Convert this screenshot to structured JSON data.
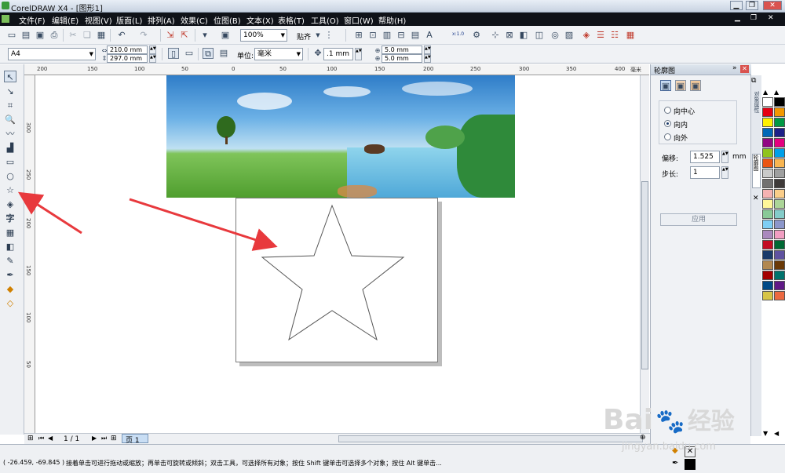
{
  "window": {
    "title": "CorelDRAW X4 - [图形1]"
  },
  "menu": [
    "文件(F)",
    "编辑(E)",
    "视图(V)",
    "版面(L)",
    "排列(A)",
    "效果(C)",
    "位图(B)",
    "文本(X)",
    "表格(T)",
    "工具(O)",
    "窗口(W)",
    "帮助(H)"
  ],
  "toolbar1": {
    "zoom": "100%",
    "snap": "贴齐",
    "small_label": "x:1.0"
  },
  "toolbar2": {
    "paper": "A4",
    "width": "210.0 mm",
    "height": "297.0 mm",
    "unit_label": "单位:",
    "unit": "毫米",
    "nudge": ".1 mm",
    "dup_x": "5.0 mm",
    "dup_y": "5.0 mm"
  },
  "ruler": {
    "h": [
      "200",
      "150",
      "100",
      "50",
      "0",
      "50",
      "100",
      "150",
      "200",
      "250",
      "300",
      "350",
      "400"
    ],
    "h_unit": "毫米",
    "v": [
      "300",
      "250",
      "200",
      "150",
      "100",
      "50"
    ]
  },
  "toolbox": {
    "text_tool": "字"
  },
  "panel": {
    "title": "轮廓图",
    "options": [
      "向中心",
      "向内",
      "向外"
    ],
    "selected": "向内",
    "offset_label": "偏移:",
    "offset_value": "1.525",
    "offset_unit": "mm",
    "steps_label": "步长:",
    "steps_value": "1",
    "apply_label": "应用"
  },
  "dock_tabs": [
    "对象属性",
    "轮廓图"
  ],
  "page_nav": {
    "counter": "1 / 1",
    "tab": "页 1"
  },
  "status": {
    "coords": "( -26.459, -69.845 )",
    "hint": "接着单击可进行拖动或缩放；再单击可旋转或倾斜；双击工具，可选择所有对象；按住 Shift 键单击可选择多个对象；按住 Alt 键单击..."
  },
  "watermark": {
    "brand": "Bai",
    "cn": "经验",
    "url": "jingyan.baidu.com"
  },
  "colors": {
    "menubar": "#0f1218",
    "accent": "#e8393d",
    "palette": [
      "#ffffff",
      "#000000",
      "#e60012",
      "#f39800",
      "#fff100",
      "#009944",
      "#0068b7",
      "#1d2088",
      "#920783",
      "#e4007f",
      "#8fc31f",
      "#00a0e9",
      "#ea5514",
      "#f8b551",
      "#c9caca",
      "#9fa0a0",
      "#727171",
      "#3e3a39",
      "#f5b2b2",
      "#facd89",
      "#fff799",
      "#acd598",
      "#89c997",
      "#84ccc9",
      "#7ecef4",
      "#8c97cb",
      "#aa89bd",
      "#f19ec2",
      "#c30d23",
      "#006934",
      "#1a3a6a",
      "#5f52a0",
      "#b28850",
      "#6a3906",
      "#a40000",
      "#00736d",
      "#004986",
      "#601986",
      "#d7c447",
      "#ec6941"
    ]
  }
}
